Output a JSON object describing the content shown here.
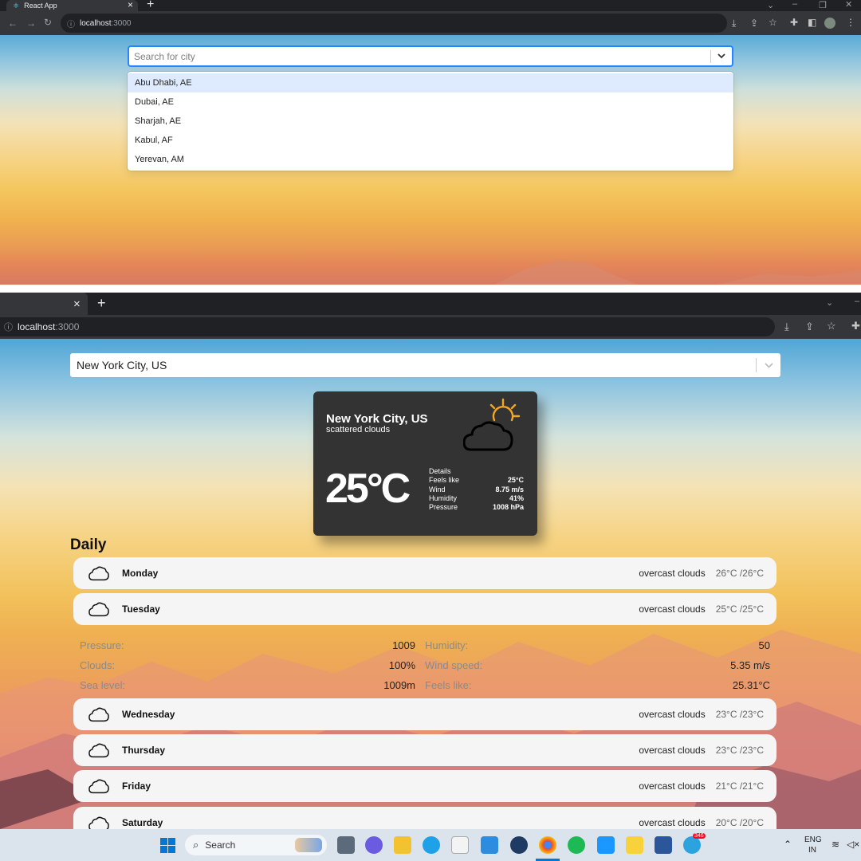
{
  "top": {
    "tab_title": "React App",
    "url_host": "localhost",
    "url_port": ":3000",
    "search_placeholder": "Search for city",
    "options": [
      "Abu Dhabi, AE",
      "Dubai, AE",
      "Sharjah, AE",
      "Kabul, AF",
      "Yerevan, AM"
    ]
  },
  "bottom": {
    "url_host": "localhost",
    "url_port": ":3000",
    "selected_city": "New York City, US",
    "current": {
      "city": "New York City, US",
      "description": "scattered clouds",
      "temperature": "25°C",
      "details_title": "Details",
      "details": [
        {
          "label": "Feels like",
          "value": "25°C"
        },
        {
          "label": "Wind",
          "value": "8.75 m/s"
        },
        {
          "label": "Humidity",
          "value": "41%"
        },
        {
          "label": "Pressure",
          "value": "1008 hPa"
        }
      ]
    },
    "daily_title": "Daily",
    "days": [
      {
        "day": "Monday",
        "description": "overcast clouds",
        "temp": "26°C /26°C"
      },
      {
        "day": "Tuesday",
        "description": "overcast clouds",
        "temp": "25°C /25°C"
      },
      {
        "day": "Wednesday",
        "description": "overcast clouds",
        "temp": "23°C /23°C"
      },
      {
        "day": "Thursday",
        "description": "overcast clouds",
        "temp": "23°C /23°C"
      },
      {
        "day": "Friday",
        "description": "overcast clouds",
        "temp": "21°C /21°C"
      },
      {
        "day": "Saturday",
        "description": "overcast clouds",
        "temp": "20°C /20°C"
      }
    ],
    "expanded": {
      "rows": [
        [
          {
            "label": "Pressure:",
            "value": "1009"
          },
          {
            "label": "Humidity:",
            "value": "50"
          }
        ],
        [
          {
            "label": "Clouds:",
            "value": "100%"
          },
          {
            "label": "Wind speed:",
            "value": "5.35 m/s"
          }
        ],
        [
          {
            "label": "Sea level:",
            "value": "1009m"
          },
          {
            "label": "Feels like:",
            "value": "25.31°C"
          }
        ]
      ]
    }
  },
  "taskbar": {
    "search_label": "Search",
    "lang": "ENG",
    "region": "IN",
    "badge": "346"
  },
  "colors": {
    "focus_border": "#2684ff",
    "option_highlight": "#deebff",
    "card_bg": "#333333",
    "sun": "#f5a623"
  }
}
